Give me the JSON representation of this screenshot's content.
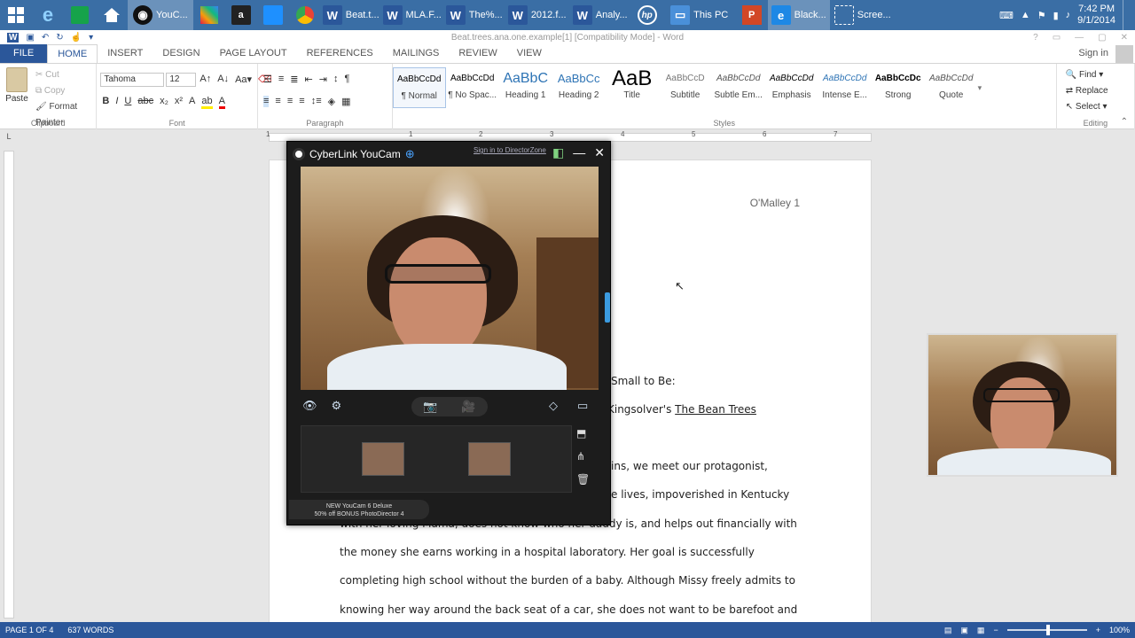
{
  "taskbar": {
    "tasks": [
      {
        "label": "YouC...",
        "icon": "youcam-icon"
      },
      {
        "label": "Beat.t...",
        "icon": "word-icon"
      },
      {
        "label": "MLA.F...",
        "icon": "word-icon"
      },
      {
        "label": "The%...",
        "icon": "word-icon"
      },
      {
        "label": "2012.f...",
        "icon": "word-icon"
      },
      {
        "label": "Analy...",
        "icon": "word-icon"
      },
      {
        "label": "This PC",
        "icon": "explorer-icon"
      },
      {
        "label": "Black...",
        "icon": "ie-icon"
      },
      {
        "label": "Scree...",
        "icon": "screen-capture-icon"
      }
    ],
    "clock_time": "7:42 PM",
    "clock_date": "9/1/2014"
  },
  "window": {
    "title": "Beat.trees.ana.one.example[1] [Compatibility Mode] - Word"
  },
  "tabs": [
    "FILE",
    "HOME",
    "INSERT",
    "DESIGN",
    "PAGE LAYOUT",
    "REFERENCES",
    "MAILINGS",
    "REVIEW",
    "VIEW"
  ],
  "sign_in": "Sign in",
  "ribbon": {
    "clipboard": {
      "label": "Clipboard",
      "paste": "Paste",
      "cut": "Cut",
      "copy": "Copy",
      "format_painter": "Format Painter"
    },
    "font": {
      "label": "Font",
      "name": "Tahoma",
      "size": "12"
    },
    "paragraph": {
      "label": "Paragraph"
    },
    "styles": {
      "label": "Styles",
      "items": [
        {
          "preview": "AaBbCcDd",
          "name": "¶ Normal"
        },
        {
          "preview": "AaBbCcDd",
          "name": "¶ No Spac..."
        },
        {
          "preview": "AaBbC",
          "name": "Heading 1"
        },
        {
          "preview": "AaBbCc",
          "name": "Heading 2"
        },
        {
          "preview": "AaB",
          "name": "Title"
        },
        {
          "preview": "AaBbCcD",
          "name": "Subtitle"
        },
        {
          "preview": "AaBbCcDd",
          "name": "Subtle Em..."
        },
        {
          "preview": "AaBbCcDd",
          "name": "Emphasis"
        },
        {
          "preview": "AaBbCcDd",
          "name": "Intense E..."
        },
        {
          "preview": "AaBbCcDc",
          "name": "Strong"
        },
        {
          "preview": "AaBbCcDd",
          "name": "Quote"
        }
      ]
    },
    "editing": {
      "label": "Editing",
      "find": "Find",
      "replace": "Replace",
      "select": "Select"
    }
  },
  "ruler": {
    "marks": [
      "1",
      "1",
      "2",
      "3",
      "4",
      "5",
      "6",
      "7"
    ]
  },
  "document": {
    "header": "O'Malley 1",
    "title_fragment": "Small to Be:",
    "subtitle_prefix": "Kingsolver's",
    "subtitle_book": "The Bean Trees",
    "lines": [
      "ins, we meet our protagonist,",
      "e lives, impoverished in Kentucky",
      "with her loving Mama, does not know who her daddy is, and helps out financially with",
      "the money she earns working in a hospital laboratory. Her goal is successfully",
      "completing high school without the burden of a baby. Although Missy freely admits to",
      "knowing her way around the back seat of a car, she does not want to be barefoot and"
    ]
  },
  "youcam": {
    "title": "CyberLink YouCam",
    "sign_in_link": "Sign in to DirectorZone",
    "promo_line1": "NEW YouCam 6 Deluxe",
    "promo_line2": "50% off BONUS PhotoDirector 4"
  },
  "status": {
    "page": "PAGE 1 OF 4",
    "words": "637 WORDS",
    "zoom": "100%"
  },
  "colors": {
    "word_blue": "#2b579a",
    "taskbar": "#3a6ea5"
  }
}
